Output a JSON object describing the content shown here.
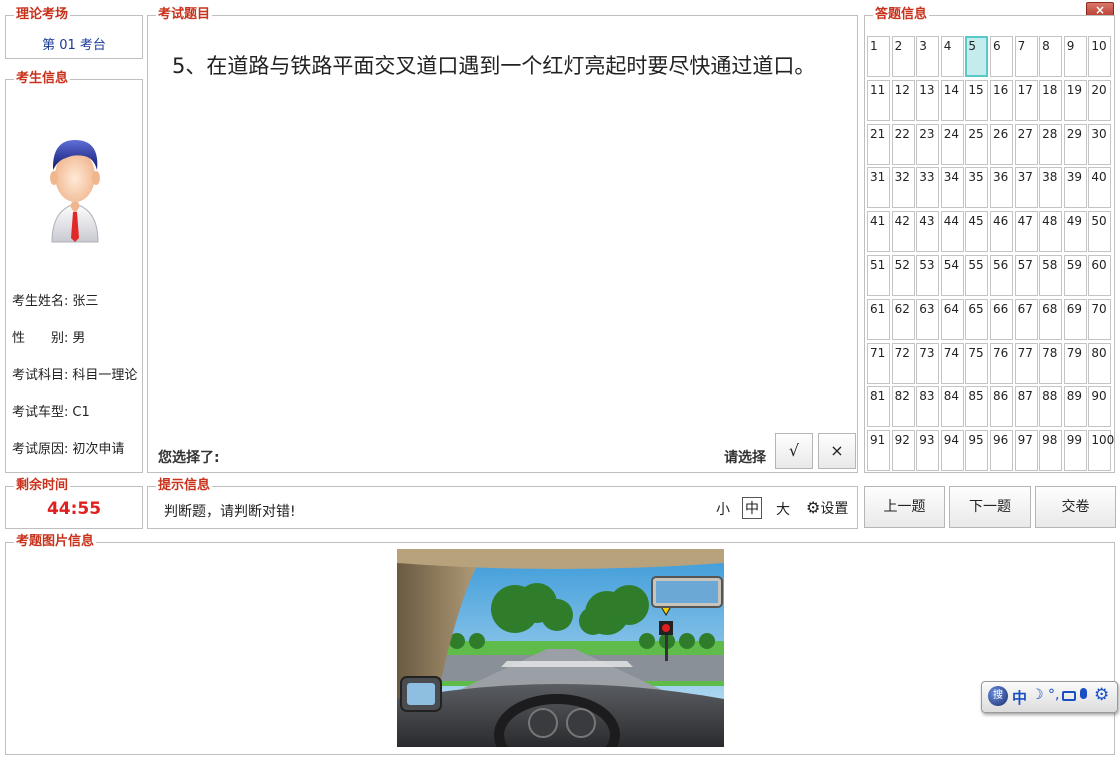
{
  "window": {
    "close_label": "×"
  },
  "exam_room": {
    "legend": "理论考场",
    "station": "第 01 考台"
  },
  "candidate": {
    "legend": "考生信息",
    "fields": [
      {
        "label": "考生姓名:",
        "value": "张三"
      },
      {
        "label": "性　　别:",
        "value": "男"
      },
      {
        "label": "考试科目:",
        "value": "科目一理论"
      },
      {
        "label": "考试车型:",
        "value": "C1"
      },
      {
        "label": "考试原因:",
        "value": "初次申请"
      }
    ]
  },
  "question": {
    "legend": "考试题目",
    "text": "5、在道路与铁路平面交叉道口遇到一个红灯亮起时要尽快通过道口。",
    "selected_label": "您选择了:",
    "choose_label": "请选择",
    "true_label": "√",
    "false_label": "×"
  },
  "answer_info": {
    "legend": "答题信息",
    "current": 5,
    "numbers": [
      "1",
      "2",
      "3",
      "4",
      "5",
      "6",
      "7",
      "8",
      "9",
      "10",
      "11",
      "12",
      "13",
      "14",
      "15",
      "16",
      "17",
      "18",
      "19",
      "20",
      "21",
      "22",
      "23",
      "24",
      "25",
      "26",
      "27",
      "28",
      "29",
      "30",
      "31",
      "32",
      "33",
      "34",
      "35",
      "36",
      "37",
      "38",
      "39",
      "40",
      "41",
      "42",
      "43",
      "44",
      "45",
      "46",
      "47",
      "48",
      "49",
      "50",
      "51",
      "52",
      "53",
      "54",
      "55",
      "56",
      "57",
      "58",
      "59",
      "60",
      "61",
      "62",
      "63",
      "64",
      "65",
      "66",
      "67",
      "68",
      "69",
      "70",
      "71",
      "72",
      "73",
      "74",
      "75",
      "76",
      "77",
      "78",
      "79",
      "80",
      "81",
      "82",
      "83",
      "84",
      "85",
      "86",
      "87",
      "88",
      "89",
      "90",
      "91",
      "92",
      "93",
      "94",
      "95",
      "96",
      "97",
      "98",
      "99",
      "100"
    ]
  },
  "timer": {
    "legend": "剩余时间",
    "value": "44:55",
    "color": "#e02020"
  },
  "hint": {
    "legend": "提示信息",
    "text": "判断题，请判断对错!",
    "font_small": "小",
    "font_medium": "中",
    "font_large": "大",
    "settings_label": "设置"
  },
  "nav": {
    "prev_label": "上一题",
    "next_label": "下一题",
    "submit_label": "交卷"
  },
  "image_panel": {
    "legend": "考题图片信息"
  },
  "ime_toolbar": {
    "icons": [
      "ime-logo-icon",
      "chinese-mode-icon",
      "moon-icon",
      "punctuation-icon",
      "keyboard-icon",
      "microphone-icon",
      "gear-icon"
    ],
    "mode_label": "中"
  },
  "colors": {
    "legend": "#c8321c",
    "station": "#1a3a9a",
    "current_cell": "#c5ecec"
  }
}
